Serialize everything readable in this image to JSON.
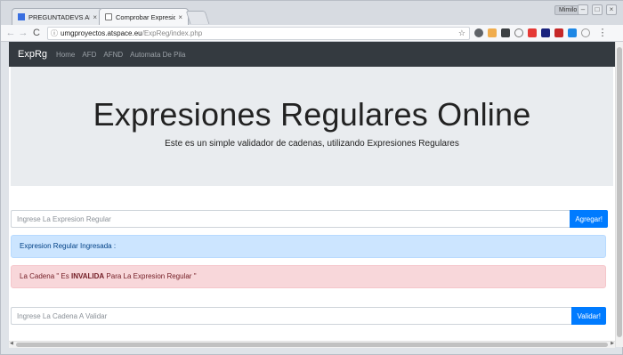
{
  "browser": {
    "tabs": [
      {
        "title": "PREGUNTADEVS APP",
        "close": "×"
      },
      {
        "title": "Comprobar Expresione",
        "close": "×"
      }
    ],
    "user_badge": "Mimilo",
    "window_buttons": [
      "–",
      "□",
      "×"
    ],
    "nav": {
      "back": "←",
      "forward": "→",
      "reload": "C",
      "info": "ⓘ"
    },
    "url": {
      "domain": "umgproyectos.atspace.eu",
      "path": "/ExpReg/index.php"
    },
    "star": "☆",
    "menu": "⋮"
  },
  "page": {
    "brand": "ExpRg",
    "nav_links": [
      "Home",
      "AFD",
      "AFND",
      "Automata De Pila"
    ],
    "title": "Expresiones Regulares Online",
    "subtitle": "Este es un simple validador de cadenas, utilizando Expresiones Regulares",
    "regex_input": {
      "placeholder": "Ingrese La Expresion Regular",
      "value": "",
      "button": "Agregar!"
    },
    "info_alert": "Expresion Regular Ingresada :",
    "danger_alert": {
      "prefix": "La Cadena \" Es ",
      "bold": "INVALIDA",
      "suffix": " Para La Expresion Regular \""
    },
    "string_input": {
      "placeholder": "Ingrese La Cadena A Validar",
      "value": "",
      "button": "Validar!"
    }
  },
  "colors": {
    "navbar": "#343a40",
    "jumbotron": "#e9ecef",
    "primary": "#007bff",
    "info_bg": "#cce5ff",
    "danger_bg": "#f8d7da"
  }
}
